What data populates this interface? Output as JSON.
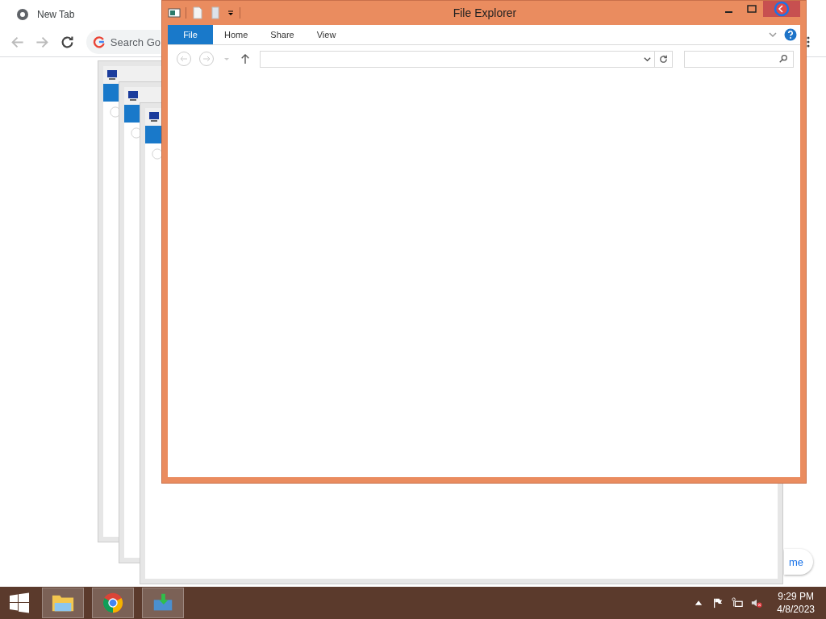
{
  "browser": {
    "tab": {
      "title": "New Tab"
    },
    "omnibox": {
      "placeholder": "Search Go"
    },
    "shortcut": {
      "label": "me"
    }
  },
  "explorer": {
    "title": "File Explorer",
    "ribbon_tabs": [
      {
        "label": "File",
        "selected": true
      },
      {
        "label": "Home",
        "selected": false
      },
      {
        "label": "Share",
        "selected": false
      },
      {
        "label": "View",
        "selected": false
      }
    ]
  },
  "taskbar": {
    "apps": [
      {
        "kind": "explorer"
      },
      {
        "kind": "chrome"
      },
      {
        "kind": "install"
      }
    ],
    "clock": {
      "time": "9:29 PM",
      "date": "4/8/2023"
    }
  }
}
